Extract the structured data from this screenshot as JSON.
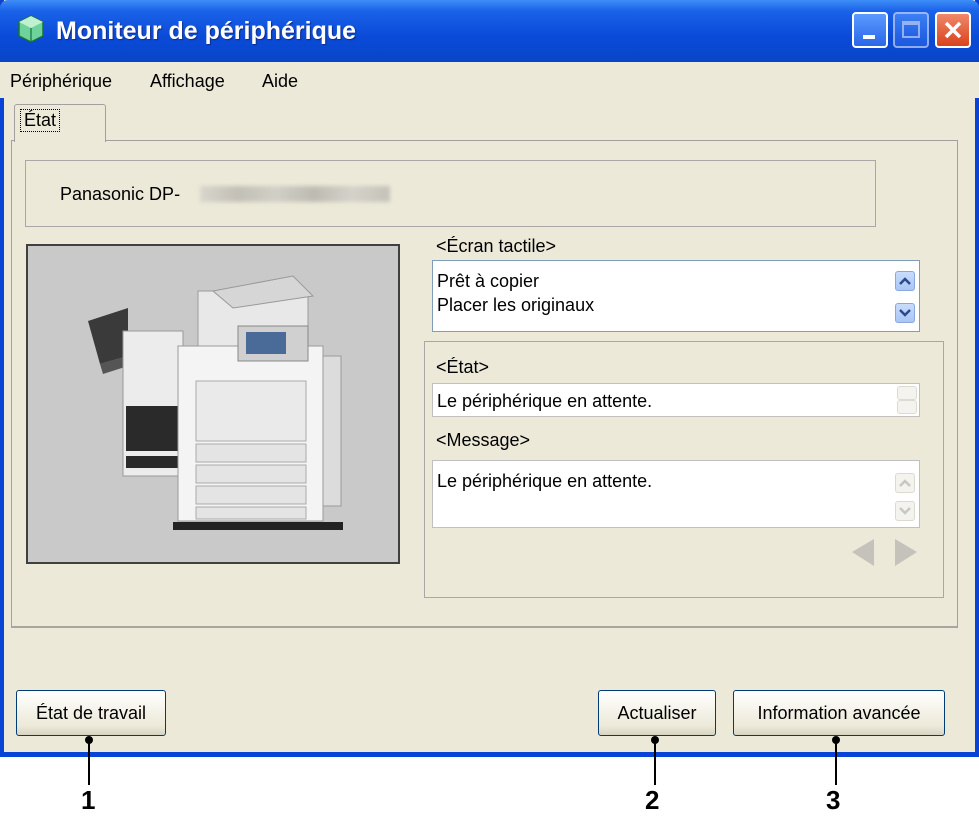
{
  "window": {
    "title": "Moniteur de périphérique",
    "icon": "device-monitor-icon"
  },
  "menu": [
    "Périphérique",
    "Affichage",
    "Aide"
  ],
  "tabs": [
    {
      "label": "État"
    }
  ],
  "device": {
    "name": "Panasonic DP-"
  },
  "touch_screen": {
    "label": "<Écran tactile>",
    "lines": [
      "Prêt à copier",
      "Placer les originaux"
    ]
  },
  "state": {
    "label": "<État>",
    "value": "Le périphérique en attente."
  },
  "message": {
    "label": "<Message>",
    "value": "Le périphérique en attente."
  },
  "buttons": {
    "job_status": "État de travail",
    "refresh": "Actualiser",
    "advanced": "Information avancée"
  },
  "callouts": [
    "1",
    "2",
    "3"
  ],
  "colors": {
    "titlebar": "#0a4ad8",
    "face": "#ece9d8",
    "close": "#d8431c"
  }
}
